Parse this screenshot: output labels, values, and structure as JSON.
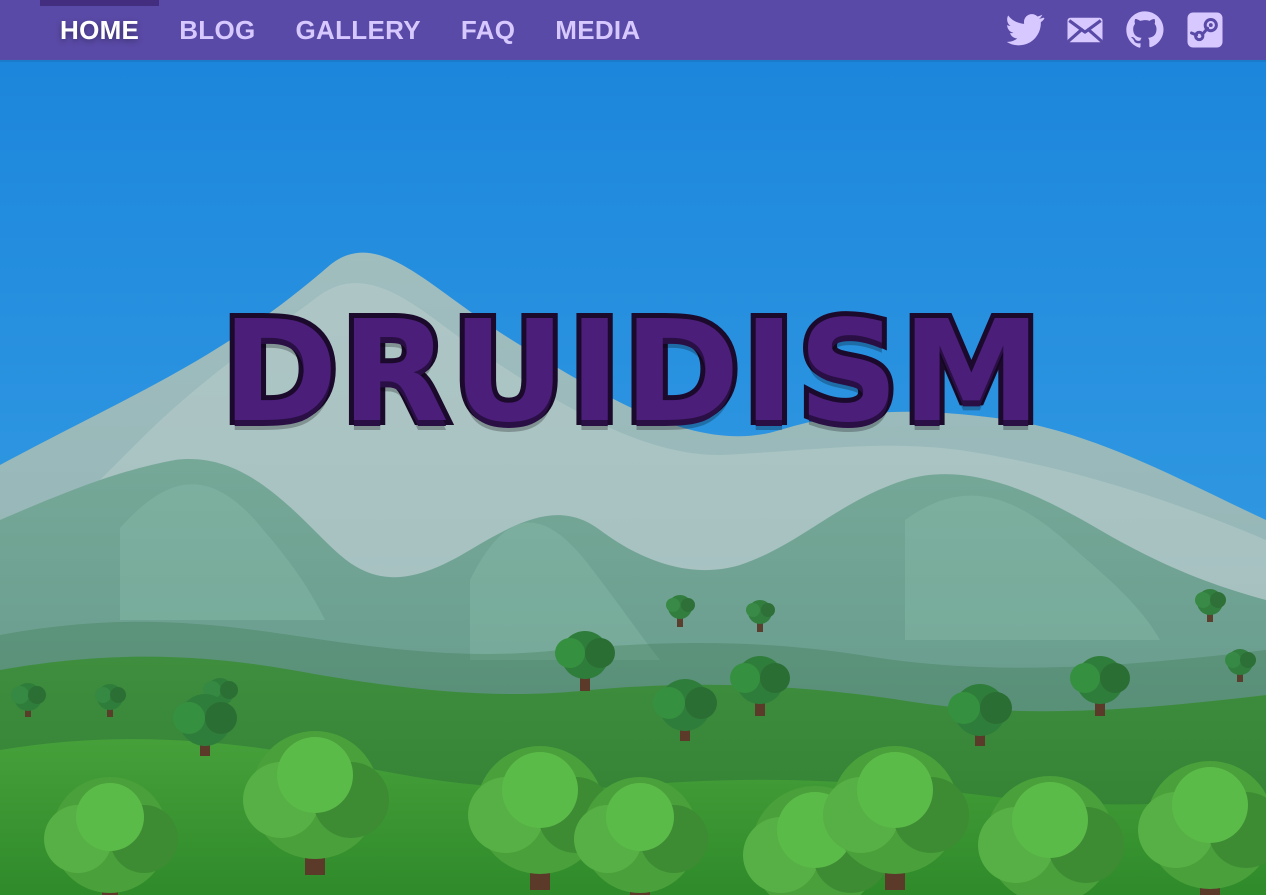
{
  "nav": {
    "items": [
      {
        "label": "HOME",
        "active": true
      },
      {
        "label": "BLOG",
        "active": false
      },
      {
        "label": "GALLERY",
        "active": false
      },
      {
        "label": "FAQ",
        "active": false
      },
      {
        "label": "MEDIA",
        "active": false
      }
    ]
  },
  "social": {
    "icons": [
      {
        "name": "twitter-icon"
      },
      {
        "name": "mail-icon"
      },
      {
        "name": "github-icon"
      },
      {
        "name": "steam-icon"
      }
    ]
  },
  "hero": {
    "title": "DRUIDISM"
  },
  "colors": {
    "nav_bg": "#5a4aa7",
    "nav_text": "#d7c9ff",
    "nav_text_active": "#ffffff",
    "logo_fill": "#4b1e7a",
    "logo_outline": "#1b0a2b"
  }
}
